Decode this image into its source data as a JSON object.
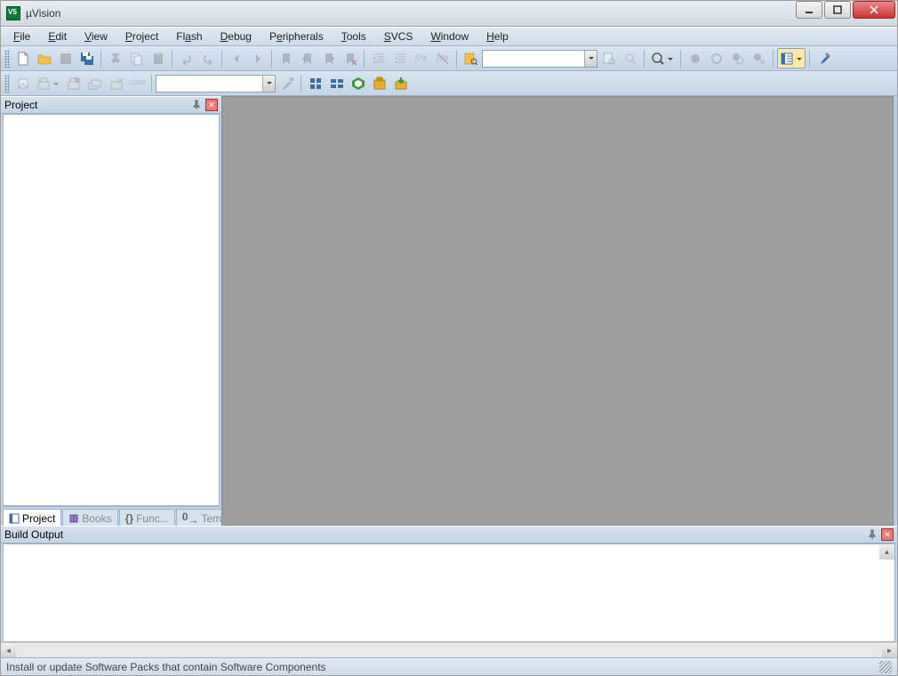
{
  "window": {
    "title": "µVision"
  },
  "menu": {
    "file": {
      "label": "File",
      "accel": "F"
    },
    "edit": {
      "label": "Edit",
      "accel": "E"
    },
    "view": {
      "label": "View",
      "accel": "V"
    },
    "project": {
      "label": "Project",
      "accel": "P"
    },
    "flash": {
      "label": "Flash",
      "accel": "a"
    },
    "debug": {
      "label": "Debug",
      "accel": "D"
    },
    "peripherals": {
      "label": "Peripherals",
      "accel": "e"
    },
    "tools": {
      "label": "Tools",
      "accel": "T"
    },
    "svcs": {
      "label": "SVCS",
      "accel": "S"
    },
    "window": {
      "label": "Window",
      "accel": "W"
    },
    "help": {
      "label": "Help",
      "accel": "H"
    }
  },
  "toolbar1": {
    "find_text": ""
  },
  "toolbar2": {
    "target_text": "",
    "load_label": "LOAD"
  },
  "panels": {
    "project": {
      "title": "Project",
      "tabs": {
        "project": "Project",
        "books": "Books",
        "functions": "Func...",
        "templates": "Temp..."
      }
    },
    "build_output": {
      "title": "Build Output"
    }
  },
  "status": {
    "text": "Install or update Software Packs that contain Software Components"
  }
}
